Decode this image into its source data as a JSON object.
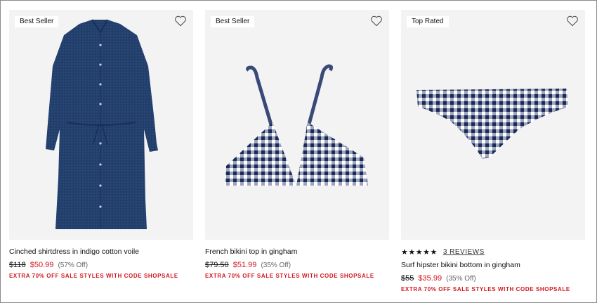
{
  "colors": {
    "sale_red": "#d2161f",
    "card_bg": "#f3f3f3",
    "navy": "#1f3864"
  },
  "products": [
    {
      "badge": "Best Seller",
      "wishlist_icon": "heart-outline-icon",
      "name": "Cinched shirtdress in indigo cotton voile",
      "original_price": "$118",
      "sale_price": "$50.99",
      "discount": "(57% Off)",
      "promo": "EXTRA 70% OFF SALE STYLES WITH CODE SHOPSALE"
    },
    {
      "badge": "Best Seller",
      "wishlist_icon": "heart-outline-icon",
      "name": "French bikini top in gingham",
      "original_price": "$79.50",
      "sale_price": "$51.99",
      "discount": "(35% Off)",
      "promo": "EXTRA 70% OFF SALE STYLES WITH CODE SHOPSALE"
    },
    {
      "badge": "Top Rated",
      "wishlist_icon": "heart-outline-icon",
      "rating_stars": "★★★★★",
      "rating_value": 5,
      "reviews": "3 REVIEWS",
      "name": "Surf hipster bikini bottom in gingham",
      "original_price": "$55",
      "sale_price": "$35.99",
      "discount": "(35% Off)",
      "promo": "EXTRA 70% OFF SALE STYLES WITH CODE SHOPSALE"
    }
  ]
}
